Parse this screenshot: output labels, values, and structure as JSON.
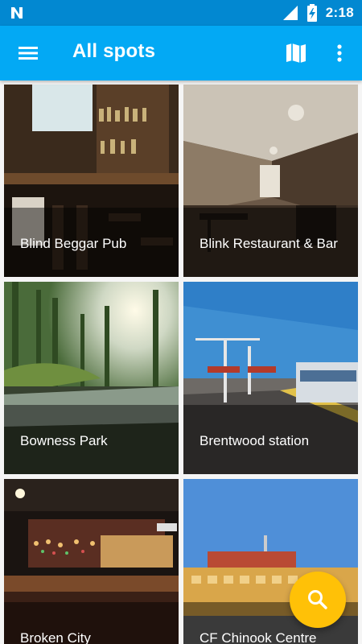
{
  "status_bar": {
    "time": "2:18"
  },
  "app_bar": {
    "title": "All spots"
  },
  "spots": [
    {
      "name": "Blind Beggar Pub"
    },
    {
      "name": "Blink Restaurant & Bar"
    },
    {
      "name": "Bowness Park"
    },
    {
      "name": "Brentwood station"
    },
    {
      "name": "Broken City"
    },
    {
      "name": "CF Chinook Centre"
    }
  ],
  "colors": {
    "primary": "#03a9f4",
    "primary_dark": "#0288d1",
    "accent": "#ffc107"
  }
}
